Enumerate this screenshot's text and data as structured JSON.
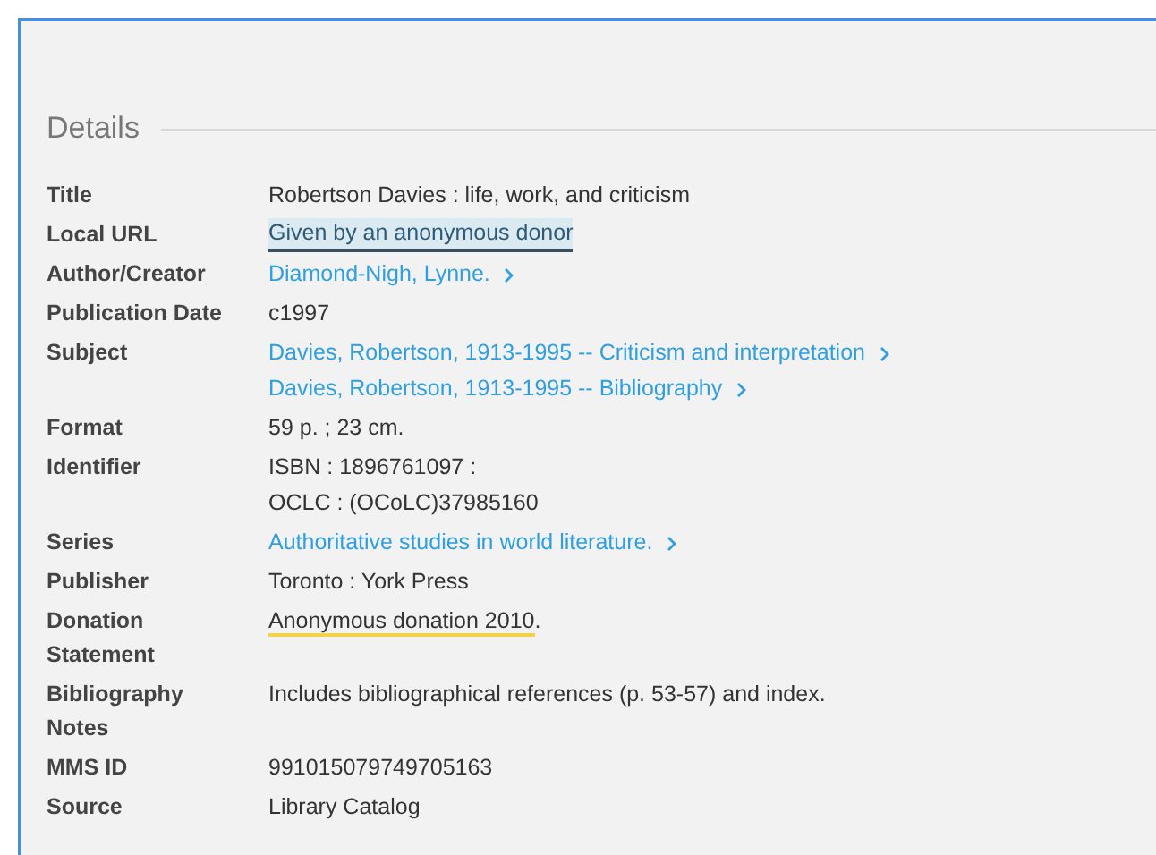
{
  "section": {
    "title": "Details"
  },
  "rows": [
    {
      "label": "Title",
      "values": [
        {
          "kind": "plain",
          "text": "Robertson Davies : life, work, and criticism"
        }
      ]
    },
    {
      "label": "Local URL",
      "values": [
        {
          "kind": "highlighted_link",
          "text": "Given by an anonymous donor"
        }
      ]
    },
    {
      "label": "Author/Creator",
      "values": [
        {
          "kind": "link",
          "text": "Diamond-Nigh, Lynne."
        }
      ]
    },
    {
      "label": "Publication Date",
      "values": [
        {
          "kind": "plain",
          "text": "c1997"
        }
      ]
    },
    {
      "label": "Subject",
      "values": [
        {
          "kind": "link",
          "text": "Davies, Robertson, 1913-1995 -- Criticism and interpretation"
        },
        {
          "kind": "link",
          "text": "Davies, Robertson, 1913-1995 -- Bibliography"
        }
      ]
    },
    {
      "label": "Format",
      "values": [
        {
          "kind": "plain",
          "text": "59 p. ; 23 cm."
        }
      ]
    },
    {
      "label": "Identifier",
      "values": [
        {
          "kind": "plain",
          "text": "ISBN : 1896761097 :"
        },
        {
          "kind": "plain",
          "text": "OCLC : (OCoLC)37985160"
        }
      ]
    },
    {
      "label": "Series",
      "values": [
        {
          "kind": "link",
          "text": "Authoritative studies in world literature."
        }
      ]
    },
    {
      "label": "Publisher",
      "values": [
        {
          "kind": "plain",
          "text": "Toronto : York Press"
        }
      ]
    },
    {
      "label": "Donation Statement",
      "values": [
        {
          "kind": "marked",
          "text": "Anonymous donation 2010",
          "trailing": "."
        }
      ]
    },
    {
      "label": "Bibliography Notes",
      "values": [
        {
          "kind": "plain",
          "text": "Includes bibliographical references (p. 53-57) and index."
        }
      ]
    },
    {
      "label": "MMS ID",
      "values": [
        {
          "kind": "plain",
          "text": "991015079749705163"
        }
      ]
    },
    {
      "label": "Source",
      "values": [
        {
          "kind": "plain",
          "text": "Library Catalog"
        }
      ]
    }
  ]
}
